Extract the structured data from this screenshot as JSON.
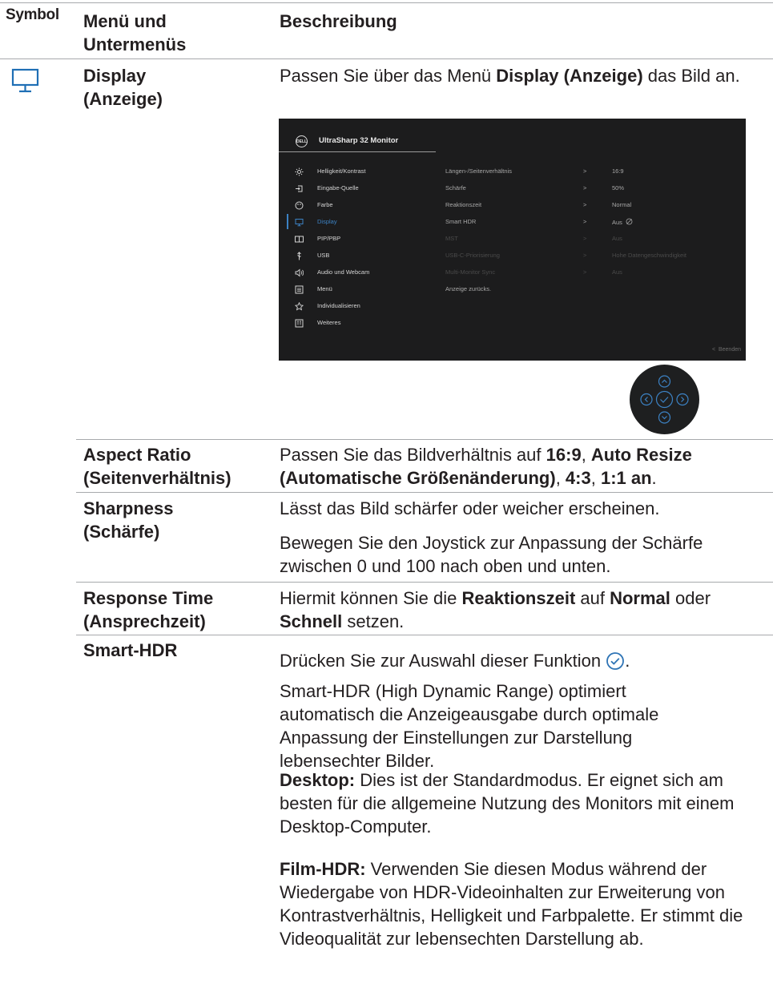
{
  "header": {
    "symbol": "Symbol",
    "menu": "Menü und Untermenüs",
    "description": "Beschreibung"
  },
  "display": {
    "icon": "monitor-icon",
    "name": "Display (Anzeige)",
    "desc_pre": "Passen Sie über das Menü ",
    "desc_bold": "Display (Anzeige)",
    "desc_post": " das Bild an."
  },
  "osd": {
    "logo": "DELL",
    "title": "UltraSharp 32 Monitor",
    "menu": [
      {
        "icon": "sun-icon",
        "label": "Helligkeit/Kontrast"
      },
      {
        "icon": "input-source-icon",
        "label": "Eingabe-Quelle"
      },
      {
        "icon": "palette-icon",
        "label": "Farbe"
      },
      {
        "icon": "monitor-icon",
        "label": "Display"
      },
      {
        "icon": "pip-icon",
        "label": "PIP/PBP"
      },
      {
        "icon": "usb-icon",
        "label": "USB"
      },
      {
        "icon": "speaker-icon",
        "label": "Audio und Webcam"
      },
      {
        "icon": "menu-icon",
        "label": "Menü"
      },
      {
        "icon": "star-icon",
        "label": "Individualisieren"
      },
      {
        "icon": "info-icon",
        "label": "Weiteres"
      }
    ],
    "rows": [
      {
        "label": "Längen-/Seitenverhältnis",
        "arrow": ">",
        "value": "16:9"
      },
      {
        "label": "Schärfe",
        "arrow": ">",
        "value": "50%"
      },
      {
        "label": "Reaktionszeit",
        "arrow": ">",
        "value": "Normal"
      },
      {
        "label": "Smart HDR",
        "arrow": ">",
        "value": "Aus"
      },
      {
        "label": "MST",
        "arrow": ">",
        "value": "Aus"
      },
      {
        "label": "USB-C-Priorisierung",
        "arrow": ">",
        "value": "Hohe Datengeschwindigkeit"
      },
      {
        "label": "Multi-Monitor Sync",
        "arrow": ">",
        "value": "Aus"
      },
      {
        "label": "Anzeige zurücks.",
        "arrow": "",
        "value": ""
      }
    ],
    "exit": "Beenden",
    "colors": {
      "background": "#1c1c1d",
      "accent": "#3c82c4"
    }
  },
  "joystick": {
    "icon": "joystick-icon"
  },
  "aspect": {
    "name": "Aspect Ratio (Seitenverhältnis)",
    "t1": "Passen Sie das Bildverhältnis auf ",
    "b1": "16:9",
    "t2": ", ",
    "b2": "Auto Resize (Automatische Größenänderung)",
    "t3": ", ",
    "b3": "4:3",
    "t4": ", ",
    "b4": "1:1 an",
    "t5": "."
  },
  "sharpness": {
    "name": "Sharpness (Schärfe)",
    "p1": "Lässt das Bild schärfer oder weicher erscheinen.",
    "p2": "Bewegen Sie den Joystick zur Anpassung der Schärfe zwischen 0 und 100 nach oben und unten."
  },
  "response": {
    "name": "Response Time (Ansprechzeit)",
    "t1": "Hiermit können Sie die ",
    "b1": "Reaktionszeit",
    "t2": " auf ",
    "b2": "Normal",
    "t3": " oder ",
    "b3": "Schnell",
    "t4": " setzen."
  },
  "smarthdr": {
    "name": "Smart-HDR",
    "p1": "Drücken Sie zur Auswahl dieser Funktion",
    "p1_end": ".",
    "p1_icon": "check-circle-icon",
    "p2": "Smart-HDR (High Dynamic Range) optimiert automatisch die Anzeigeausgabe durch optimale Anpassung der Einstellungen zur Darstellung lebensechter Bilder.",
    "p3_bold": "Desktop:",
    "p3": " Dies ist der Standardmodus. Er eignet sich am besten für die allgemeine Nutzung des Monitors mit einem Desktop-Computer.",
    "p4_bold": "Film-HDR:",
    "p4": " Verwenden Sie diesen Modus während der Wiedergabe von HDR-Videoinhalten zur Erweiterung von Kontrastverhältnis, Helligkeit und Farbpalette. Er stimmt die Videoqualität zur lebensechten Darstellung ab."
  }
}
